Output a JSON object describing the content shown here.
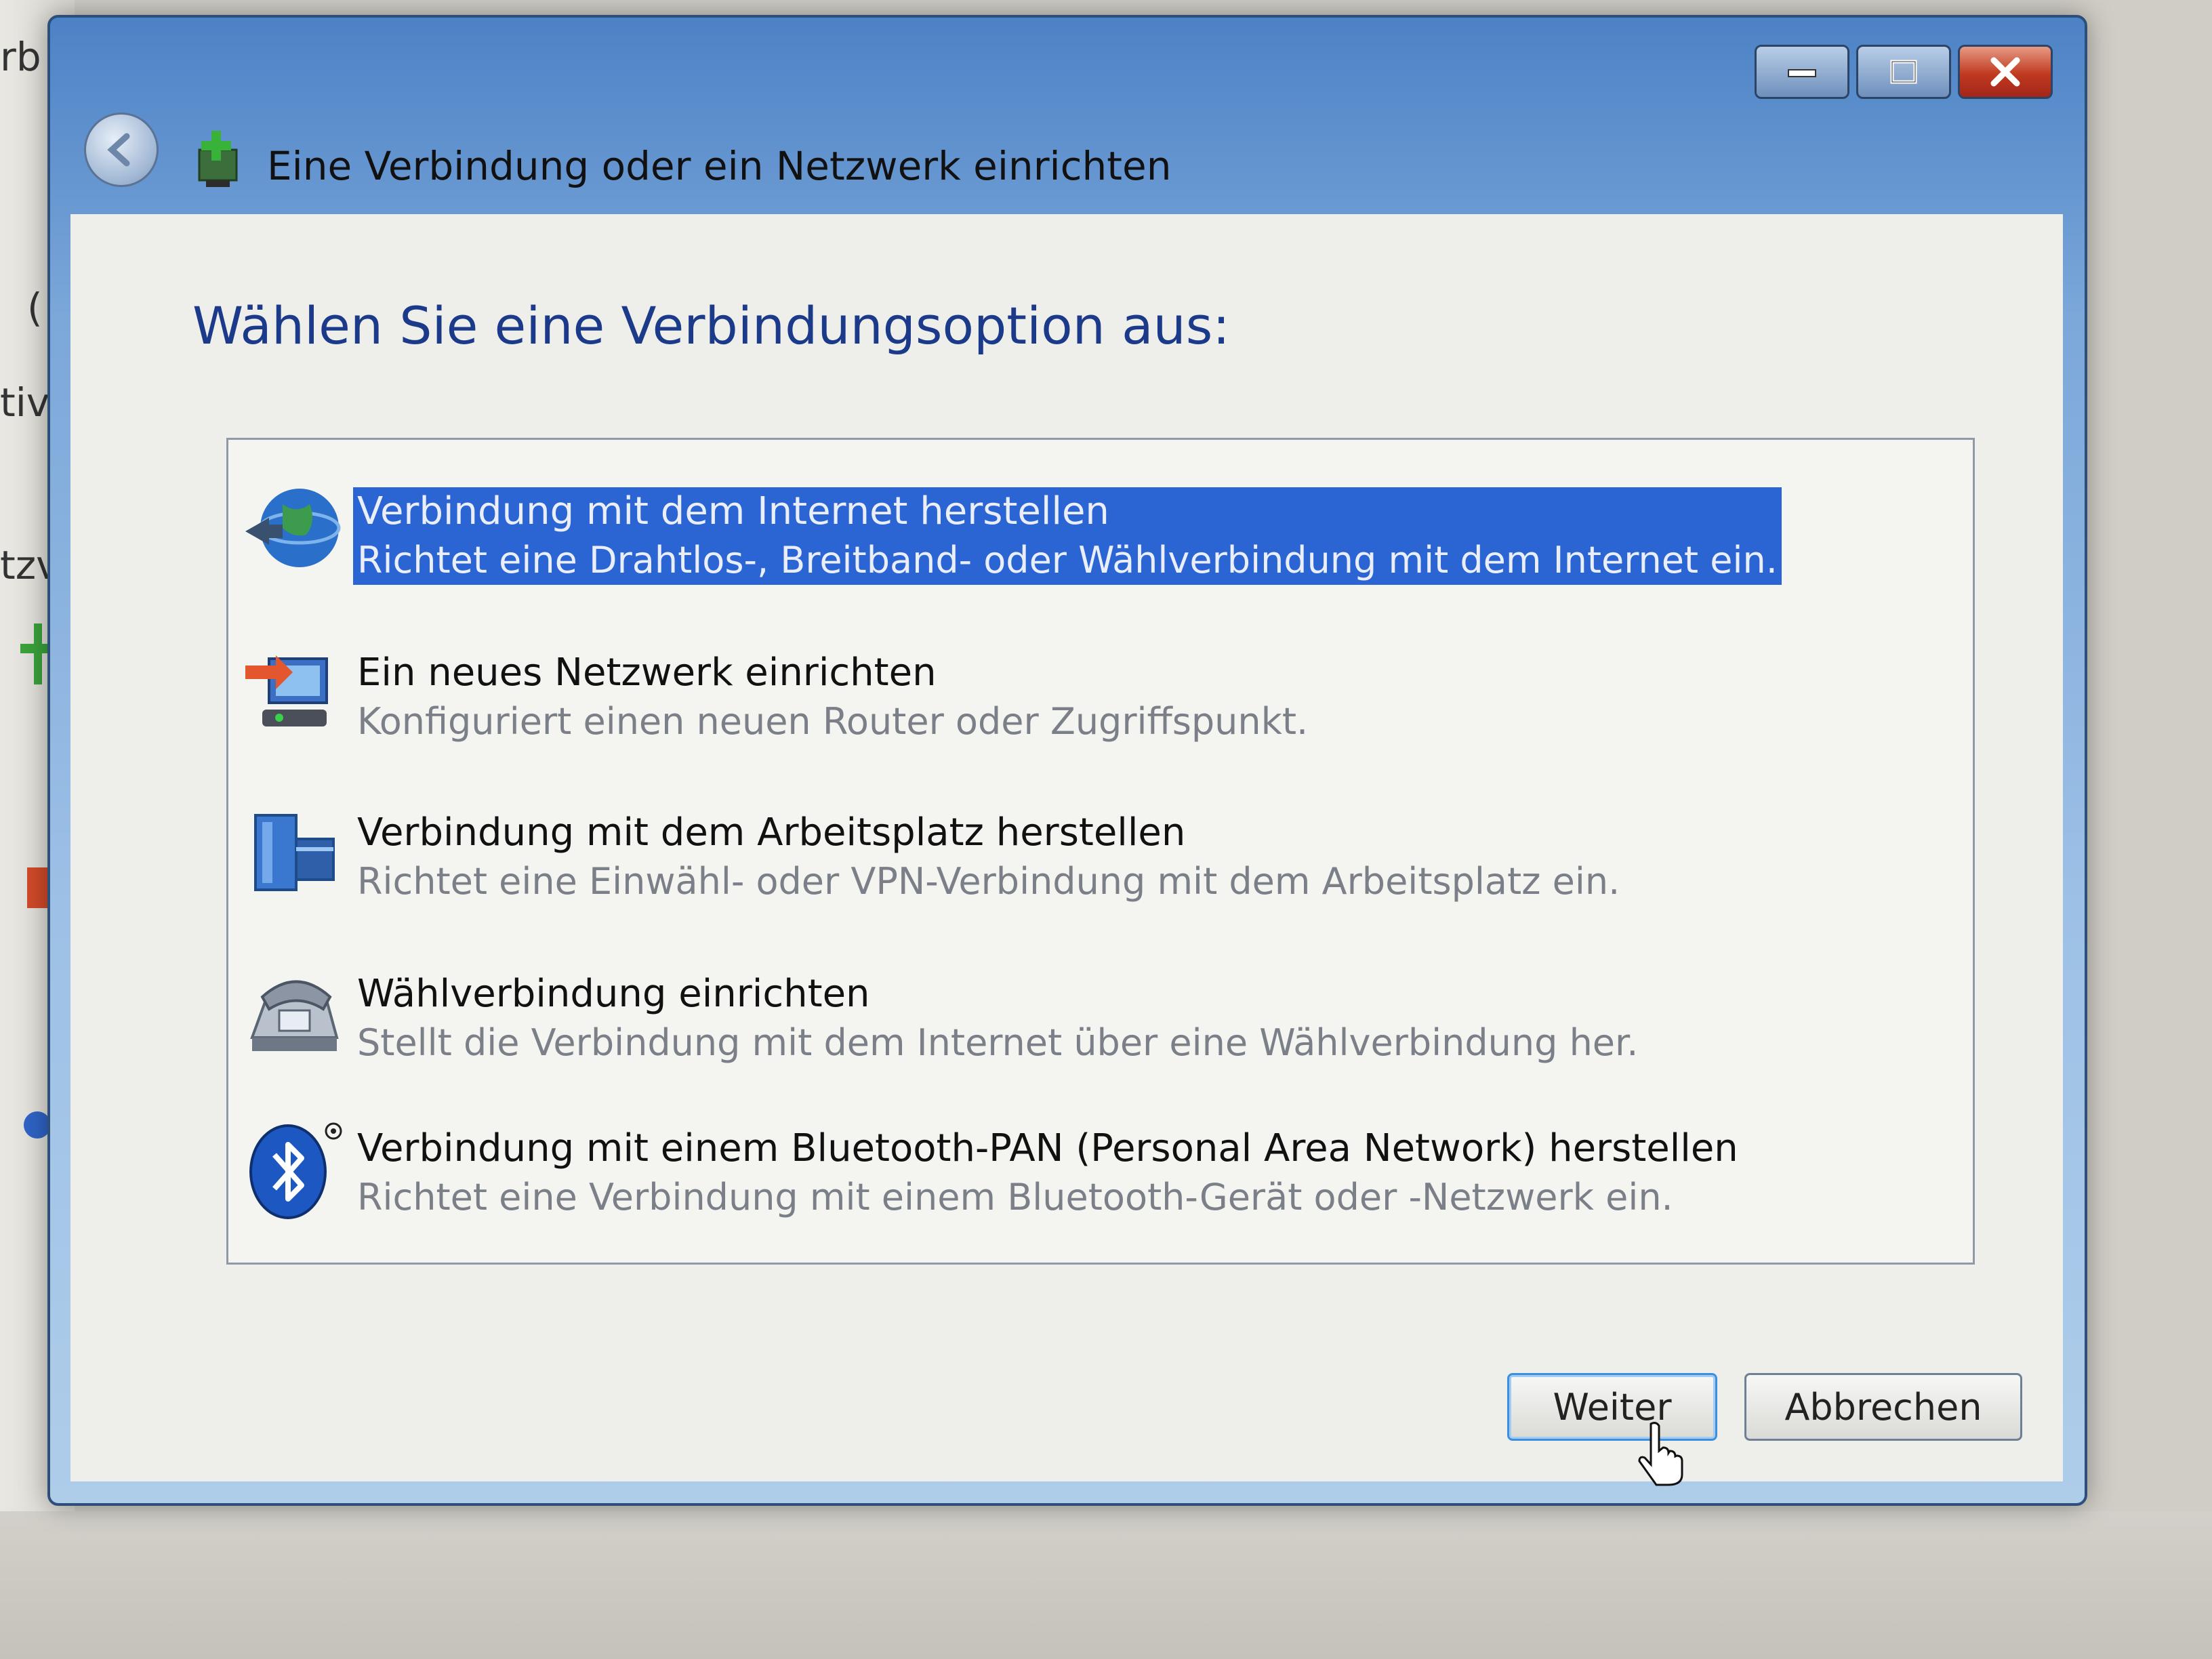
{
  "background": {
    "fragments": [
      "rb",
      "(",
      "tiv",
      "tzv"
    ]
  },
  "window": {
    "title": "Eine Verbindung oder ein Netzwerk einrichten",
    "controls": {
      "minimize": "minimize-icon",
      "maximize": "maximize-icon",
      "close": "close-icon"
    }
  },
  "main": {
    "heading": "Wählen Sie eine Verbindungsoption aus:",
    "options": [
      {
        "icon": "globe-icon",
        "title": "Verbindung mit dem Internet herstellen",
        "description": "Richtet eine Drahtlos-, Breitband- oder Wählverbindung mit dem Internet ein.",
        "selected": true
      },
      {
        "icon": "new-network-icon",
        "title": "Ein neues Netzwerk einrichten",
        "description": "Konfiguriert einen neuen Router oder Zugriffspunkt.",
        "selected": false
      },
      {
        "icon": "workplace-icon",
        "title": "Verbindung mit dem Arbeitsplatz herstellen",
        "description": "Richtet eine Einwähl- oder VPN-Verbindung mit dem Arbeitsplatz ein.",
        "selected": false
      },
      {
        "icon": "dialup-phone-icon",
        "title": "Wählverbindung einrichten",
        "description": "Stellt die Verbindung mit dem Internet über eine Wählverbindung her.",
        "selected": false
      },
      {
        "icon": "bluetooth-icon",
        "title": "Verbindung mit einem Bluetooth-PAN (Personal Area Network) herstellen",
        "description": "Richtet eine Verbindung mit einem Bluetooth-Gerät oder -Netzwerk ein.",
        "selected": false
      }
    ]
  },
  "buttons": {
    "next": "Weiter",
    "cancel": "Abbrechen"
  },
  "colors": {
    "selection": "#2b64d3",
    "heading": "#1c3a8a",
    "description": "#7b7f88"
  }
}
